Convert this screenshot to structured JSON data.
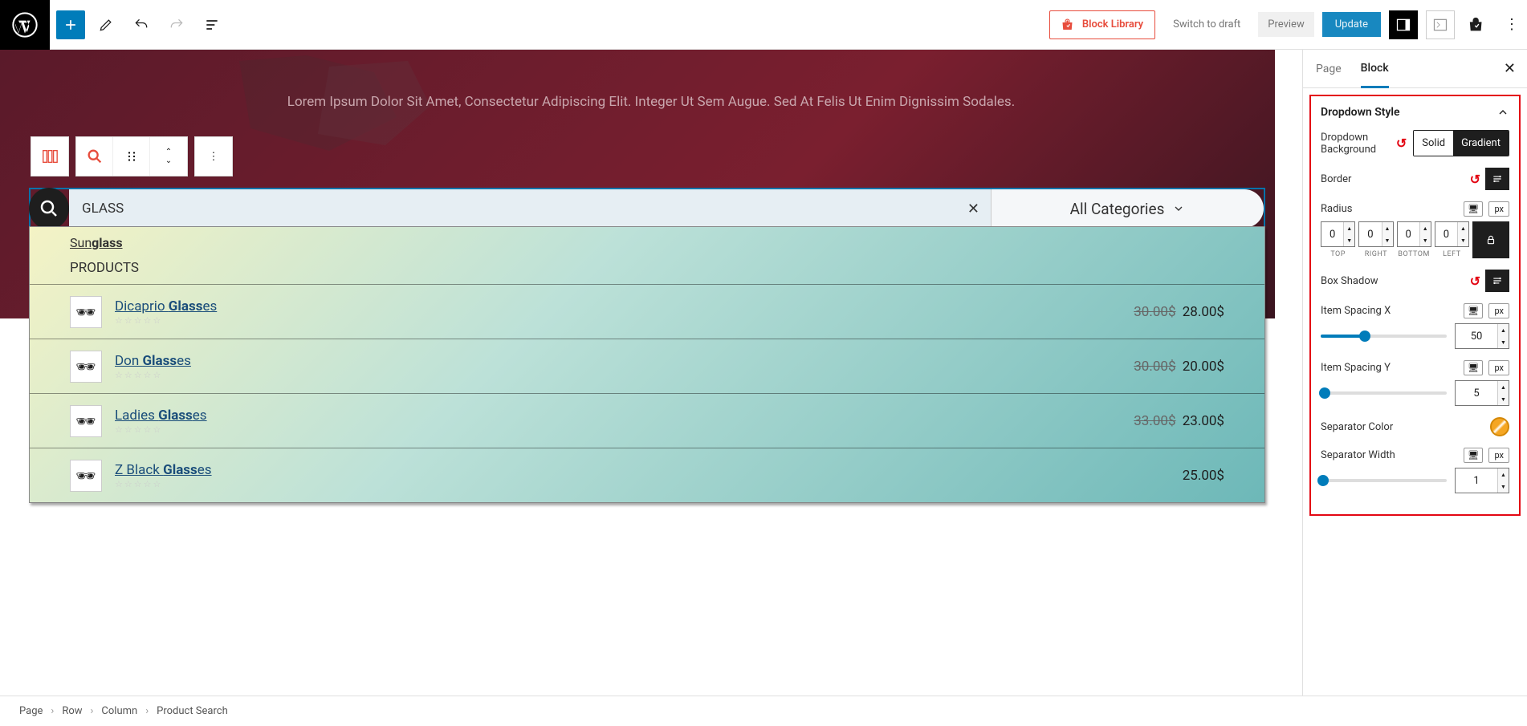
{
  "toolbar": {
    "block_library": "Block Library",
    "switch_draft": "Switch to draft",
    "preview": "Preview",
    "update": "Update"
  },
  "hero": {
    "tagline": "Lorem Ipsum Dolor Sit Amet, Consectetur Adipiscing Elit. Integer Ut Sem Augue. Sed At Felis Ut Enim Dignissim Sodales."
  },
  "search": {
    "query": "GLASS",
    "category": "All Categories",
    "suggestion_prefix": "Sun",
    "suggestion_match": "glass",
    "section_label": "PRODUCTS",
    "products": [
      {
        "name_pre": "Dicaprio ",
        "name_match": "Glass",
        "name_post": "es",
        "old_price": "30.00$",
        "price": "28.00$"
      },
      {
        "name_pre": "Don ",
        "name_match": "Glass",
        "name_post": "es",
        "old_price": "30.00$",
        "price": "20.00$"
      },
      {
        "name_pre": "Ladies ",
        "name_match": "Glass",
        "name_post": "es",
        "old_price": "33.00$",
        "price": "23.00$"
      },
      {
        "name_pre": "Z Black ",
        "name_match": "Glass",
        "name_post": "es",
        "old_price": "",
        "price": "25.00$"
      }
    ]
  },
  "sidebar": {
    "tab_page": "Page",
    "tab_block": "Block",
    "panel_title": "Dropdown Style",
    "bg_label": "Dropdown Background",
    "bg_solid": "Solid",
    "bg_gradient": "Gradient",
    "border_label": "Border",
    "radius_label": "Radius",
    "px": "px",
    "radius": {
      "top": "0",
      "right": "0",
      "bottom": "0",
      "left": "0"
    },
    "radius_labels": {
      "top": "TOP",
      "right": "RIGHT",
      "bottom": "BOTTOM",
      "left": "LEFT"
    },
    "box_shadow": "Box Shadow",
    "spacing_x_label": "Item Spacing X",
    "spacing_x": "50",
    "spacing_y_label": "Item Spacing Y",
    "spacing_y": "5",
    "sep_color": "Separator Color",
    "sep_width_label": "Separator Width",
    "sep_width": "1"
  },
  "breadcrumb": [
    "Page",
    "Row",
    "Column",
    "Product Search"
  ]
}
